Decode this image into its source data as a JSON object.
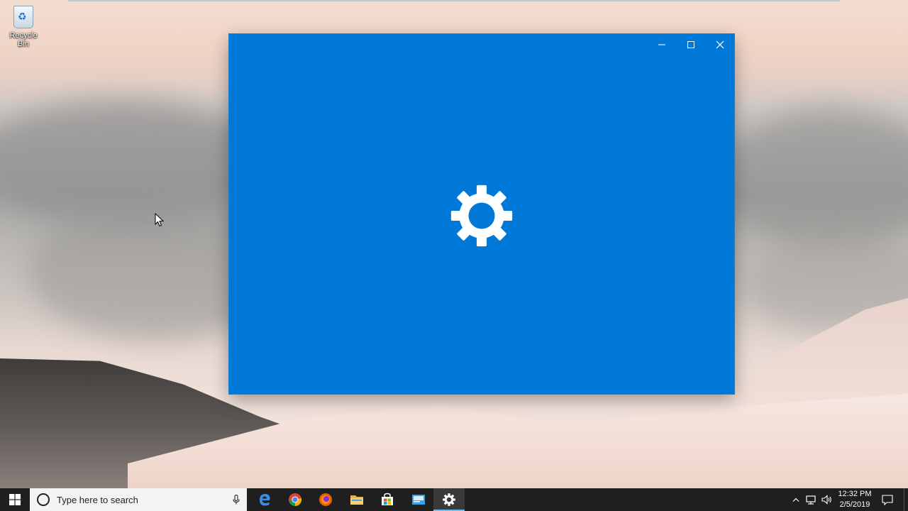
{
  "desktop": {
    "icons": [
      {
        "label": "Recycle Bin",
        "icon": "recycle-bin-icon"
      }
    ]
  },
  "window": {
    "app": "Settings",
    "state": "loading-splash",
    "background_color": "#0078d7",
    "splash_icon": "gear-icon",
    "controls": {
      "minimize_icon": "minimize-icon",
      "maximize_icon": "maximize-icon",
      "close_icon": "close-icon"
    }
  },
  "taskbar": {
    "start_icon": "windows-logo-icon",
    "search": {
      "placeholder": "Type here to search",
      "mic_icon": "microphone-icon"
    },
    "pinned": [
      {
        "name": "edge",
        "icon": "edge-icon",
        "active": false
      },
      {
        "name": "chrome",
        "icon": "chrome-icon",
        "active": false
      },
      {
        "name": "firefox",
        "icon": "firefox-icon",
        "active": false
      },
      {
        "name": "file-explorer",
        "icon": "folder-icon",
        "active": false
      },
      {
        "name": "store",
        "icon": "store-icon",
        "active": false
      },
      {
        "name": "mail",
        "icon": "mail-icon",
        "active": false
      },
      {
        "name": "settings",
        "icon": "gear-icon",
        "active": true
      }
    ],
    "tray": {
      "chevron_icon": "chevron-up-icon",
      "network_icon": "network-icon",
      "volume_icon": "volume-icon",
      "time": "12:32 PM",
      "date": "2/5/2019",
      "action_center_icon": "notification-icon"
    }
  }
}
